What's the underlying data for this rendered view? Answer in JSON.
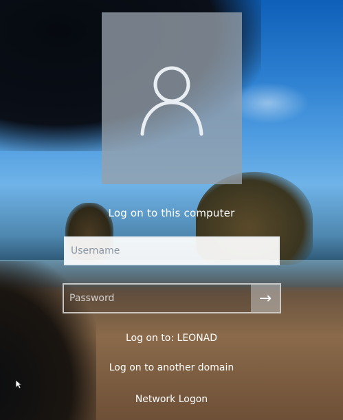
{
  "login": {
    "heading": "Log on to this computer",
    "username_placeholder": "Username",
    "password_placeholder": "Password",
    "submit_icon": "arrow-right-icon",
    "avatar_icon": "user-icon"
  },
  "links": {
    "logon_to_domain": "Log on to: LEONAD",
    "another_domain": "Log on to another domain",
    "network_logon": "Network Logon"
  },
  "colors": {
    "tile": "#969fa9",
    "text": "#ffffff"
  }
}
